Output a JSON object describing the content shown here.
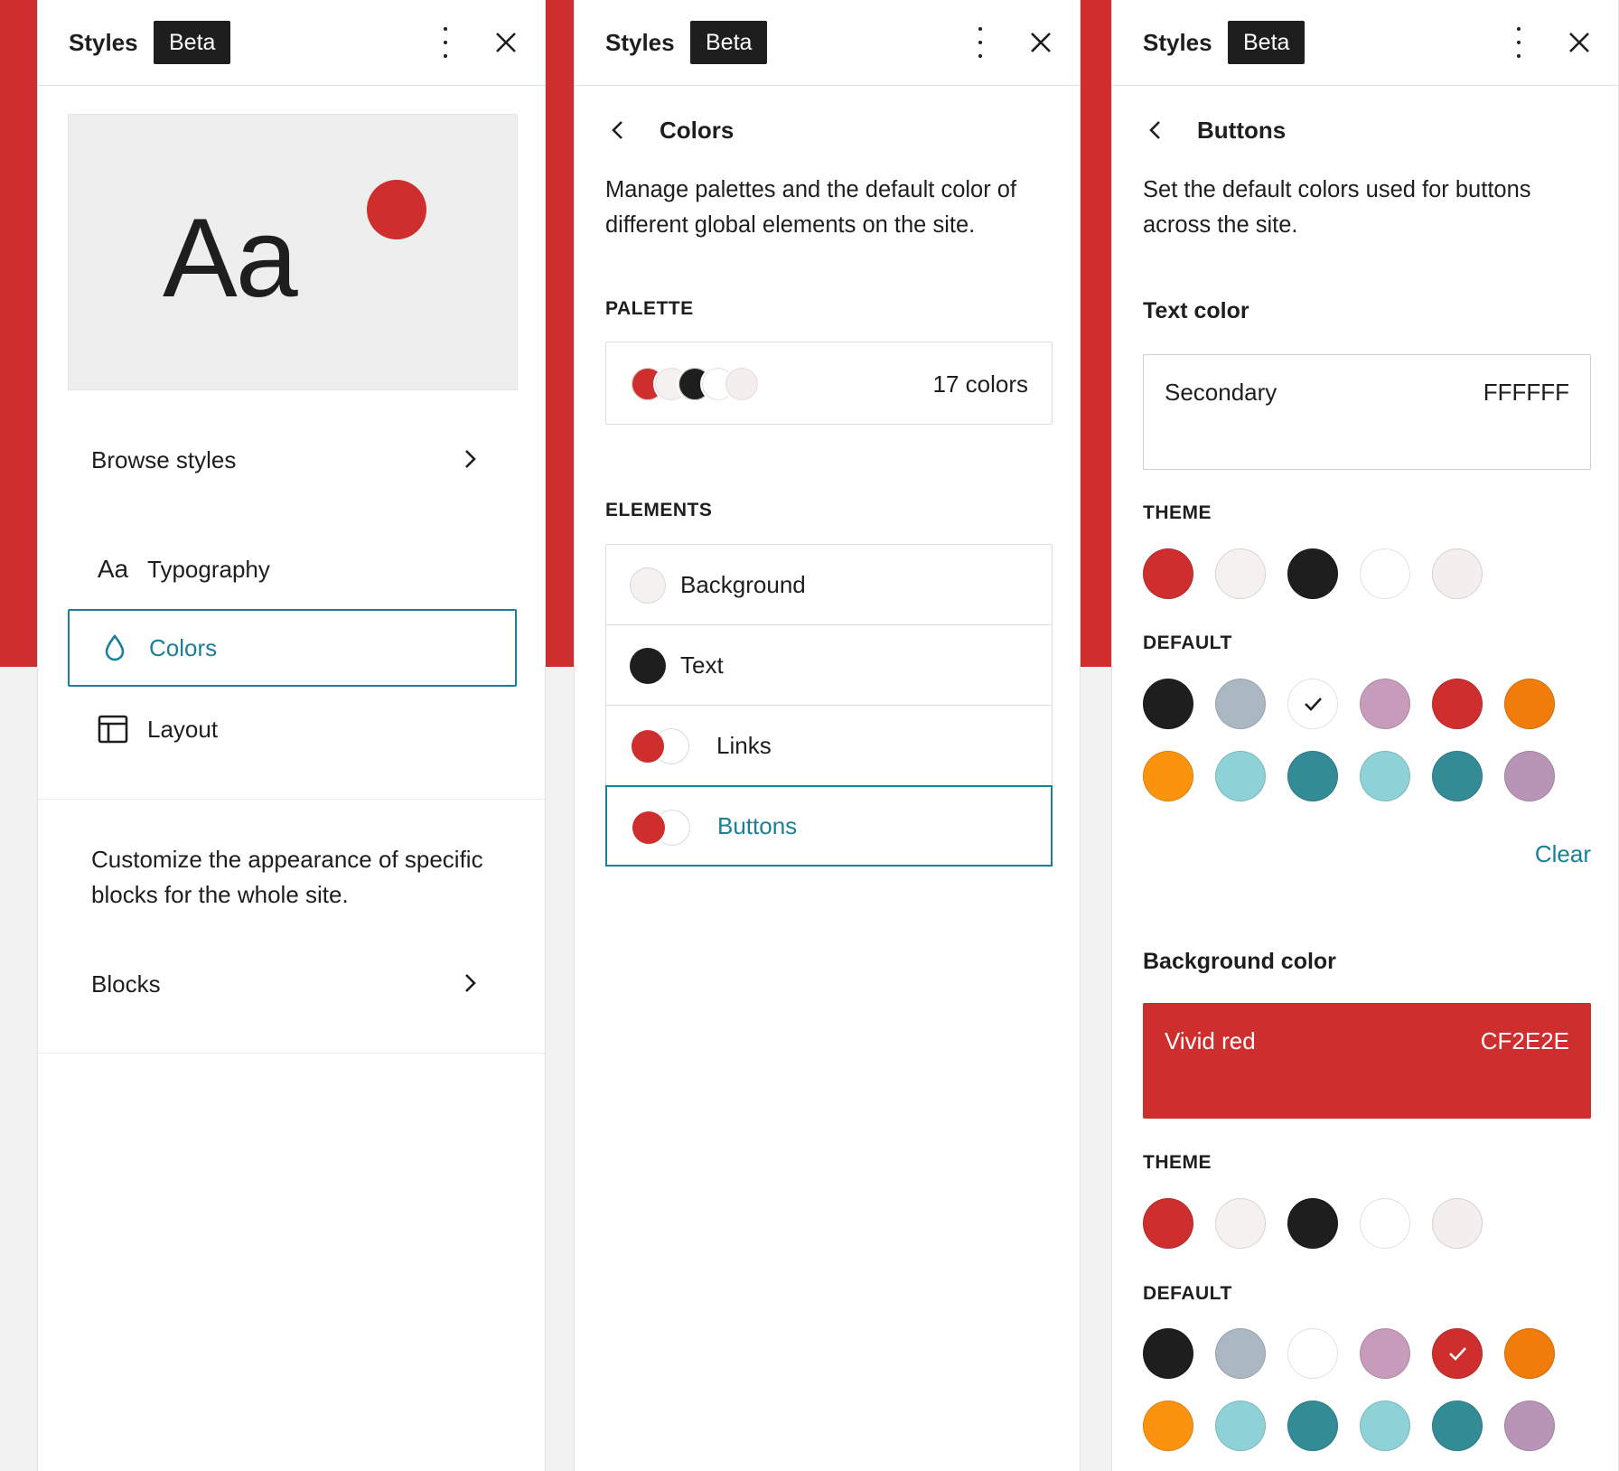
{
  "colors": {
    "accent": "#1a8099",
    "vivid_red": "#cf2e2e",
    "dark": "#1e1e1e"
  },
  "panels": [
    {
      "header": {
        "title": "Styles",
        "badge": "Beta"
      },
      "preview": {
        "sample_text": "Aa"
      },
      "browse_label": "Browse styles",
      "nav": [
        {
          "icon": "typography-icon",
          "icon_text": "Aa",
          "label": "Typography"
        },
        {
          "icon": "droplet-icon",
          "label": "Colors",
          "selected": true
        },
        {
          "icon": "layout-icon",
          "label": "Layout"
        }
      ],
      "blocks_description": "Customize the appearance of specific blocks for the whole site.",
      "blocks_label": "Blocks"
    },
    {
      "header": {
        "title": "Styles",
        "badge": "Beta"
      },
      "back_title": "Colors",
      "description": "Manage palettes and the default color of different global elements on the site.",
      "palette_heading": "PALETTE",
      "palette_count": "17 colors",
      "elements_heading": "ELEMENTS",
      "elements": [
        {
          "label": "Background"
        },
        {
          "label": "Text"
        },
        {
          "label": "Links"
        },
        {
          "label": "Buttons",
          "selected": true
        }
      ]
    },
    {
      "header": {
        "title": "Styles",
        "badge": "Beta"
      },
      "back_title": "Buttons",
      "description": "Set the default colors used for buttons across the site.",
      "text_color": {
        "heading": "Text color",
        "name": "Secondary",
        "hex": "FFFFFF",
        "theme_heading": "THEME",
        "default_heading": "DEFAULT",
        "clear_label": "Clear"
      },
      "background_color": {
        "heading": "Background color",
        "name": "Vivid red",
        "hex": "CF2E2E",
        "theme_heading": "THEME",
        "default_heading": "DEFAULT"
      }
    }
  ],
  "theme_swatches": [
    "#cf2e2e",
    "#f6f1f1",
    "#1e1e1e",
    "#ffffff",
    "#f4eeee"
  ],
  "default_swatches": [
    "#1e1e1e",
    "#abb8c3",
    "#ffffff",
    "#c79bbb",
    "#cf2e2e",
    "#f07c0c",
    "#fb930e",
    "#8ed1d6",
    "#338b95",
    "#8ed1d6",
    "#338b95",
    "#b894b6"
  ],
  "text_default_selected_index": 2,
  "bg_default_selected_index": 4
}
